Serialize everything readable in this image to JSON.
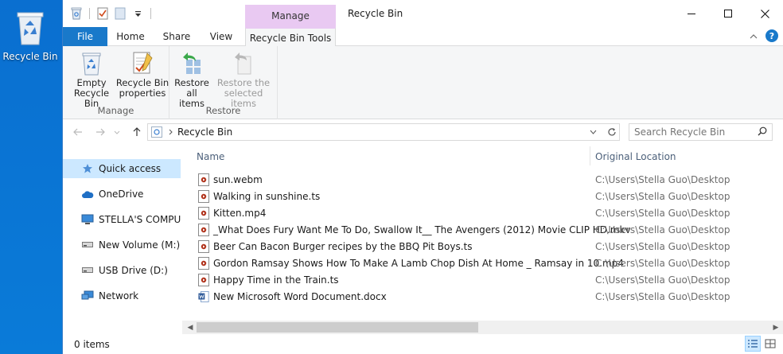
{
  "desktop": {
    "icon_label": "Recycle Bin"
  },
  "window": {
    "title": "Recycle Bin",
    "context_tab": "Manage",
    "controls": [
      "minimize",
      "maximize",
      "close"
    ]
  },
  "ribbon_tabs": {
    "file": "File",
    "home": "Home",
    "share": "Share",
    "view": "View",
    "tools": "Recycle Bin Tools"
  },
  "ribbon": {
    "manage_group": {
      "label": "Manage",
      "empty_line1": "Empty",
      "empty_line2": "Recycle Bin",
      "props_line1": "Recycle Bin",
      "props_line2": "properties"
    },
    "restore_group": {
      "label": "Restore",
      "restore_all_line1": "Restore",
      "restore_all_line2": "all items",
      "restore_sel_line1": "Restore the",
      "restore_sel_line2": "selected items"
    }
  },
  "address": {
    "path": "Recycle Bin",
    "search_placeholder": "Search Recycle Bin"
  },
  "nav": {
    "items": [
      {
        "label": "Quick access",
        "icon": "star-icon",
        "selected": true
      },
      {
        "label": "OneDrive",
        "icon": "cloud-icon"
      },
      {
        "label": "STELLA'S COMPUTER",
        "icon": "computer-icon"
      },
      {
        "label": "New Volume (M:)",
        "icon": "drive-icon"
      },
      {
        "label": "USB Drive (D:)",
        "icon": "usb-drive-icon"
      },
      {
        "label": "Network",
        "icon": "network-icon"
      }
    ]
  },
  "columns": {
    "name": "Name",
    "location": "Original Location"
  },
  "files": [
    {
      "name": "sun.webm",
      "location": "C:\\Users\\Stella Guo\\Desktop",
      "icon": "video-file-icon"
    },
    {
      "name": "Walking in sunshine.ts",
      "location": "C:\\Users\\Stella Guo\\Desktop",
      "icon": "video-file-icon"
    },
    {
      "name": "Kitten.mp4",
      "location": "C:\\Users\\Stella Guo\\Desktop",
      "icon": "video-file-icon"
    },
    {
      "name": "_What Does Fury Want Me To Do, Swallow It__ The Avengers (2012) Movie CLIP HD.mkv",
      "location": "C:\\Users\\Stella Guo\\Desktop",
      "icon": "video-file-icon"
    },
    {
      "name": "Beer Can Bacon Burger recipes by the BBQ Pit Boys.ts",
      "location": "C:\\Users\\Stella Guo\\Desktop",
      "icon": "video-file-icon"
    },
    {
      "name": "Gordon Ramsay Shows How To Make A Lamb Chop Dish At Home _ Ramsay in 10.mp4",
      "location": "C:\\Users\\Stella Guo\\Desktop",
      "icon": "video-file-icon"
    },
    {
      "name": "Happy Time in the Train.ts",
      "location": "C:\\Users\\Stella Guo\\Desktop",
      "icon": "video-file-icon"
    },
    {
      "name": "New Microsoft Word Document.docx",
      "location": "C:\\Users\\Stella Guo\\Desktop",
      "icon": "word-doc-icon"
    }
  ],
  "status": {
    "items_count": "0 items"
  },
  "colors": {
    "file_tab": "#1979ca",
    "context_tab": "#e9c9f2",
    "selection": "#cce8ff",
    "desktop": "#0a78d4"
  }
}
